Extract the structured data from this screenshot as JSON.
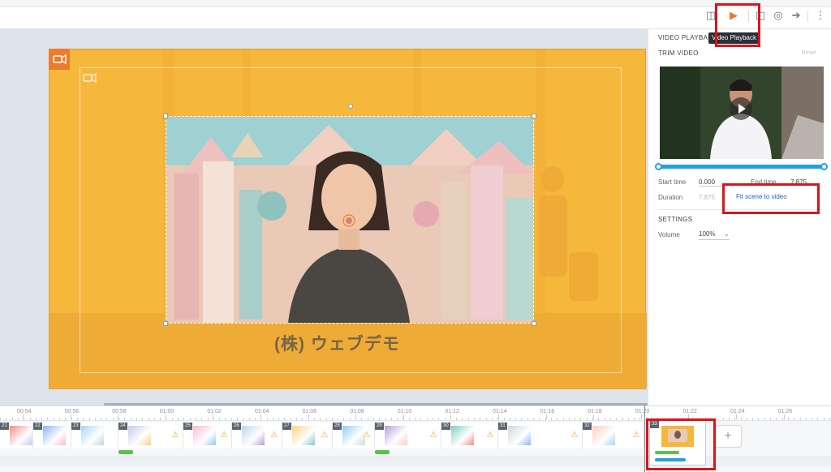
{
  "toolbar": {
    "tooltip": "Video Playback",
    "icons": [
      "scene-transition-icon",
      "video-playback-icon",
      "crop-icon",
      "animation-icon",
      "export-icon",
      "more-vertical-icon"
    ]
  },
  "canvas": {
    "company_text": "(株) ウェブデモ"
  },
  "panel": {
    "title": "VIDEO PLAYBACK",
    "trim_title": "TRIM VIDEO",
    "reset_label": "Reset",
    "start_time_label": "Start time",
    "start_time_value": "0.000",
    "end_time_label": "End time",
    "end_time_value": "7.875",
    "duration_label": "Duration",
    "duration_value": "7.875",
    "fit_label": "Fit scene to video",
    "settings_title": "SETTINGS",
    "volume_label": "Volume",
    "volume_value": "100%",
    "trim": {
      "start": 0.0,
      "end": 1.0
    }
  },
  "timeline": {
    "ticks": [
      "00:54",
      "00:56",
      "00:58",
      "01:00",
      "01:02",
      "01:04",
      "01:06",
      "01:08",
      "01:10",
      "01:12",
      "01:14",
      "01:16",
      "01:18",
      "01:20",
      "01:22",
      "01:24",
      "01:26"
    ],
    "clips": [
      {
        "num": "21",
        "warn": false
      },
      {
        "num": "22",
        "warn": false
      },
      {
        "num": "23",
        "warn": false
      },
      {
        "num": "24",
        "warn": true
      },
      {
        "num": "25",
        "warn": true
      },
      {
        "num": "26",
        "warn": true
      },
      {
        "num": "27",
        "warn": true
      },
      {
        "num": "28",
        "warn": true
      },
      {
        "num": "29",
        "warn": true
      },
      {
        "num": "30",
        "warn": true
      },
      {
        "num": "31",
        "warn": true
      },
      {
        "num": "32",
        "warn": true
      },
      {
        "num": "33",
        "warn": false
      }
    ],
    "add_label": "+"
  },
  "colors": {
    "stage": "#f5b73c",
    "accent": "#ec7b2a",
    "trim_bar": "#1ea3dc",
    "highlight_box": "#d9141b",
    "link": "#2563b8"
  }
}
